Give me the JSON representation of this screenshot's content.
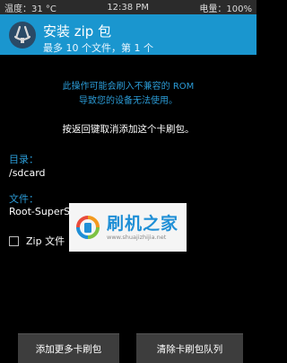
{
  "status": {
    "temp": "温度：31 °C",
    "time": "12:38 PM",
    "battery": "电量：100%"
  },
  "header": {
    "title": "安装 zip 包",
    "subtitle": "最多 10 个文件，第 1 个"
  },
  "warning": {
    "line1": "此操作可能会刷入不兼容的 ROM",
    "line2": "导致您的设备无法使用。"
  },
  "hint": "按返回键取消添加这个卡刷包。",
  "directory": {
    "label": "目录：",
    "value": "/sdcard"
  },
  "file": {
    "label": "文件：",
    "value": "Root-SuperS"
  },
  "zip_verify": {
    "label": "Zip 文件",
    "checked": false
  },
  "watermark": {
    "main": "刷机之家",
    "sub": "www.shuajizhijia.net"
  },
  "buttons": {
    "add_more": "添加更多卡刷包",
    "clear_queue": "清除卡刷包队列"
  }
}
